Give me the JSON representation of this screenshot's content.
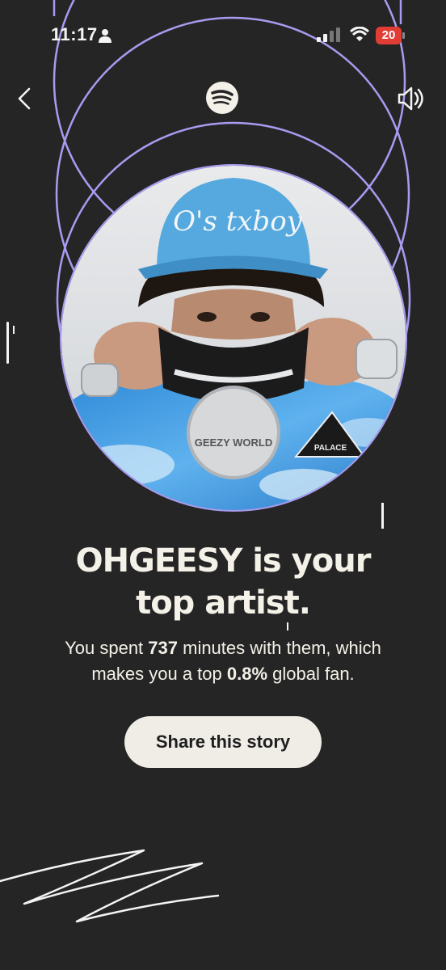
{
  "status_bar": {
    "time": "11:17",
    "battery": "20",
    "icons": [
      "person-icon",
      "signal-icon",
      "wifi-icon",
      "battery-icon"
    ]
  },
  "header": {
    "icons": [
      "back-chevron-icon",
      "spotify-logo-icon",
      "speaker-icon"
    ]
  },
  "story": {
    "artist": "OHGEESY",
    "headline_suffix_1": " is your",
    "headline_line_2": "top artist.",
    "sub_1": "You spent ",
    "minutes": "737",
    "sub_2": " minutes with them, which",
    "sub_3": "makes you a top ",
    "percent": "0.8%",
    "sub_4": " global fan.",
    "photo_hat_text": "O's txboy",
    "photo_chain_text": "GEEZY WORLD",
    "photo_patch_text": "PALACE"
  },
  "actions": {
    "share_label": "Share this story"
  },
  "colors": {
    "background": "#262525",
    "ring": "#a69cf0",
    "text": "#f4f1e8",
    "button_bg": "#f0ede6",
    "battery": "#e13d35"
  }
}
